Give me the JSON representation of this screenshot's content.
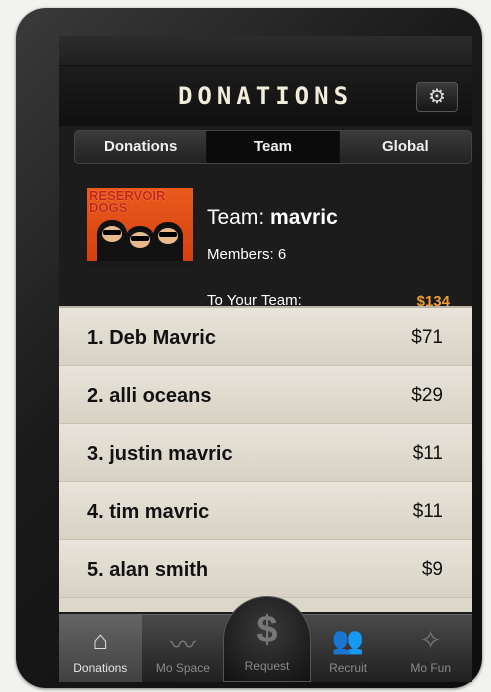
{
  "nav": {
    "title": "DONATIONS",
    "settings_icon": "gear-icon"
  },
  "segments": [
    {
      "label": "Donations",
      "active": false
    },
    {
      "label": "Team",
      "active": true
    },
    {
      "label": "Global",
      "active": false
    }
  ],
  "team": {
    "image_text": "RESERVOIR DOGS",
    "name_prefix": "Team:",
    "name": "mavric",
    "members_label": "Members:",
    "members_count": "6",
    "to_team_label": "To Your Team:",
    "to_team_amount": "$134",
    "accent_color": "#f19a32"
  },
  "leaderboard": [
    {
      "name": "1. Deb Mavric",
      "amount": "$71"
    },
    {
      "name": "2. alli oceans",
      "amount": "$29"
    },
    {
      "name": "3. justin mavric",
      "amount": "$11"
    },
    {
      "name": "4. tim mavric",
      "amount": "$11"
    },
    {
      "name": "5. alan smith",
      "amount": "$9"
    }
  ],
  "tabbar": [
    {
      "label": "Donations",
      "icon": "house-icon",
      "active": true
    },
    {
      "label": "Mo Space",
      "icon": "mustache-icon",
      "active": false
    },
    {
      "label": "Request",
      "icon": "dollar-icon",
      "active": false
    },
    {
      "label": "Recruit",
      "icon": "people-icon",
      "active": false
    },
    {
      "label": "Mo Fun",
      "icon": "mofun-logo-icon",
      "active": false
    }
  ]
}
